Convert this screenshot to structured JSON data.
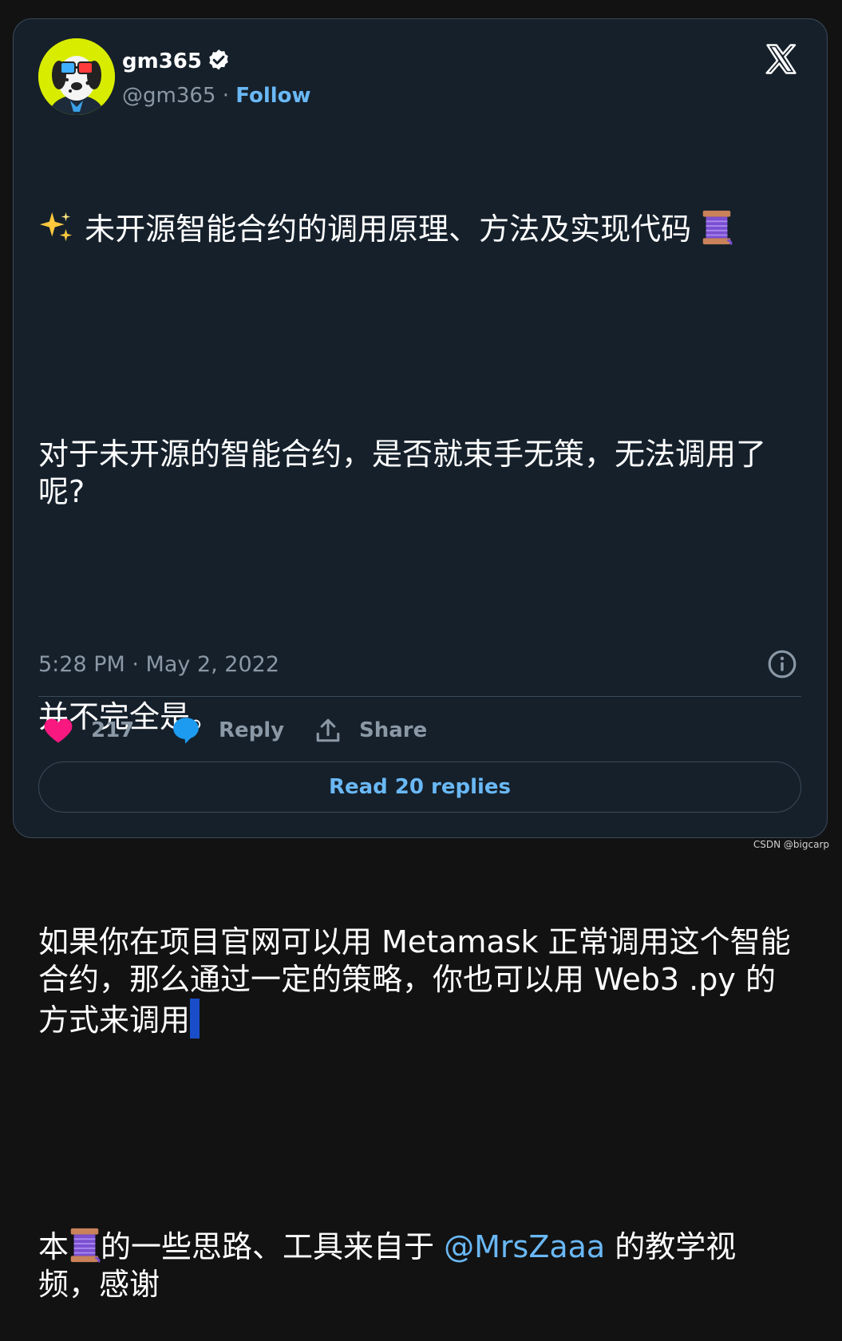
{
  "author": {
    "display_name": "gm365",
    "handle": "@gm365",
    "separator": "·",
    "follow_label": "Follow"
  },
  "tweet": {
    "title": "未开源智能合约的调用原理、方法及实现代码",
    "para1": "对于未开源的智能合约，是否就束手无策，无法调用了呢?",
    "para2": "并不完全是。",
    "para3": "如果你在项目官网可以用 Metamask 正常调用这个智能合约，那么通过一定的策略，你也可以用 Web3 .py 的方式来调用",
    "para4_before": "本",
    "para4_mid": "的一些思路、工具来自于 ",
    "mention": "@MrsZaaa",
    "para4_after": " 的教学视频，感谢"
  },
  "meta": {
    "timestamp": "5:28 PM · May 2, 2022"
  },
  "actions": {
    "like_count": "217",
    "reply_label": "Reply",
    "share_label": "Share"
  },
  "read_replies_label": "Read 20 replies",
  "watermark": "CSDN @bigcarp",
  "icons": [
    "verified-badge-icon",
    "x-logo-icon",
    "sparkles-icon",
    "thread-spool-icon",
    "info-icon",
    "heart-icon",
    "reply-bubble-icon",
    "share-icon"
  ],
  "colors": {
    "background": "#15202b",
    "accent": "#6ab8f5",
    "like": "#f91880",
    "muted": "#8b98a5"
  }
}
